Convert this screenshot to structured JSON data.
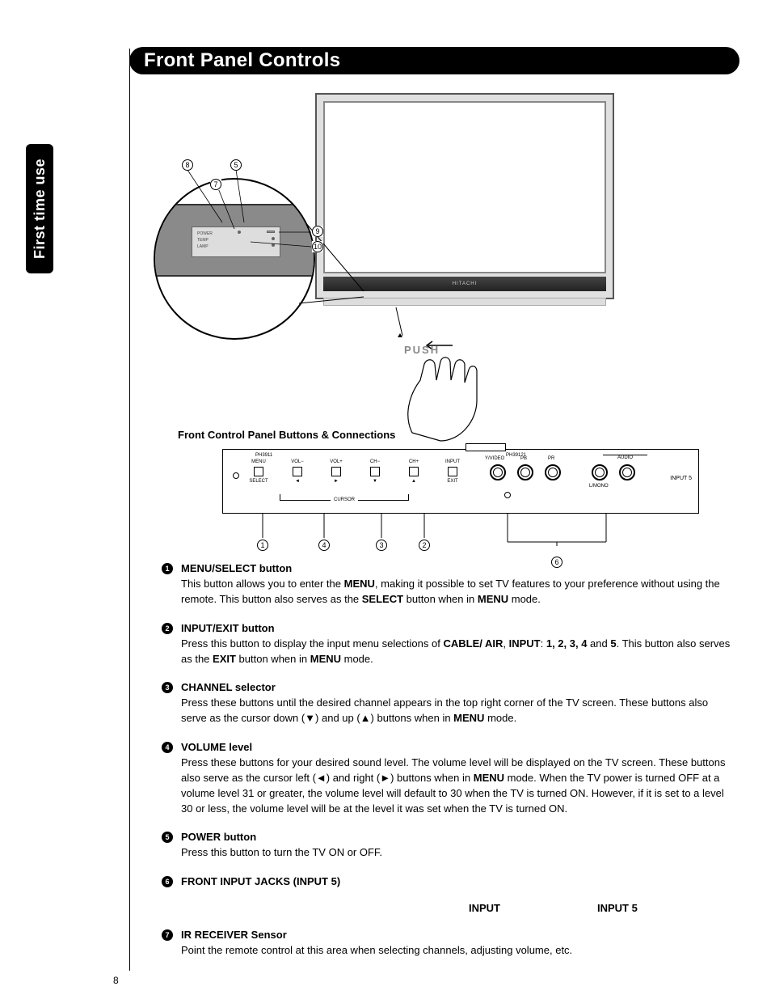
{
  "side_tab": "First time use",
  "header": "Front Panel Controls",
  "subtitle": "Front Control Panel Buttons & Connections",
  "tv_brand": "HITACHI",
  "push_label": "PUSH",
  "magnifier_labels": {
    "power": "POWER",
    "temp": "TEMP",
    "lamp": "LAMP"
  },
  "magnifier_callouts": [
    "8",
    "5",
    "7",
    "9",
    "10"
  ],
  "panel": {
    "model_left": "PH3911",
    "model_right": "PH39121",
    "buttons": [
      {
        "top": "MENU",
        "bottom": "SELECT"
      },
      {
        "top": "VOL−",
        "bottom": "◄"
      },
      {
        "top": "VOL+",
        "bottom": "►"
      },
      {
        "top": "CH−",
        "bottom": "▼"
      },
      {
        "top": "CH+",
        "bottom": "▲"
      },
      {
        "top": "INPUT",
        "bottom": "EXIT"
      }
    ],
    "cursor_label": "CURSOR",
    "jack_labels": [
      "Y/VIDEO",
      "PB",
      "PR",
      "",
      ""
    ],
    "audio_label": "AUDIO",
    "lmono_label": "L/MONO",
    "input5_label": "INPUT 5",
    "callout_numbers": [
      "1",
      "4",
      "3",
      "2",
      "6"
    ]
  },
  "defs": [
    {
      "n": "1",
      "title": "MENU/SELECT button",
      "body": "This button allows you to enter the <b>MENU</b>, making it possible to set TV features to your preference without using the remote. This button also serves as the <b>SELECT</b> button when in <b>MENU</b> mode."
    },
    {
      "n": "2",
      "title": "INPUT/EXIT button",
      "body": "Press this button to display the input menu selections of <b>CABLE/ AIR</b>, <b>INPUT</b>: <b>1, 2, 3, 4</b> and <b>5</b>. This button also serves as the <b>EXIT</b> button when in <b>MENU</b> mode."
    },
    {
      "n": "3",
      "title": "CHANNEL selector",
      "body": "Press these buttons until the desired channel appears in the top right corner of the TV screen. These buttons also serve as the cursor down (▼) and up (▲) buttons when in <b>MENU</b> mode."
    },
    {
      "n": "4",
      "title": "VOLUME level",
      "body": "Press these buttons for your desired sound level. The volume level will be displayed on the TV screen. These buttons also serve as the cursor left (◄) and right (►) buttons when in <b>MENU</b> mode. When the TV power is turned OFF at a volume level 31 or greater, the volume level will default to 30 when the TV is turned ON. However, if it is set to a level 30 or less, the volume level will be at the level it was set when the TV is turned ON."
    },
    {
      "n": "5",
      "title": "POWER button",
      "body": "Press this button to turn the TV ON or OFF."
    },
    {
      "n": "6",
      "title": "FRONT INPUT JACKS (INPUT 5)",
      "title_plain": true,
      "body": ""
    },
    {
      "n": "7",
      "title": "IR RECEIVER Sensor",
      "body": "Point the remote control at this area when selecting channels, adjusting volume, etc."
    }
  ],
  "standalone_labels": {
    "a": "INPUT",
    "b": "INPUT 5"
  },
  "page_number": "8"
}
